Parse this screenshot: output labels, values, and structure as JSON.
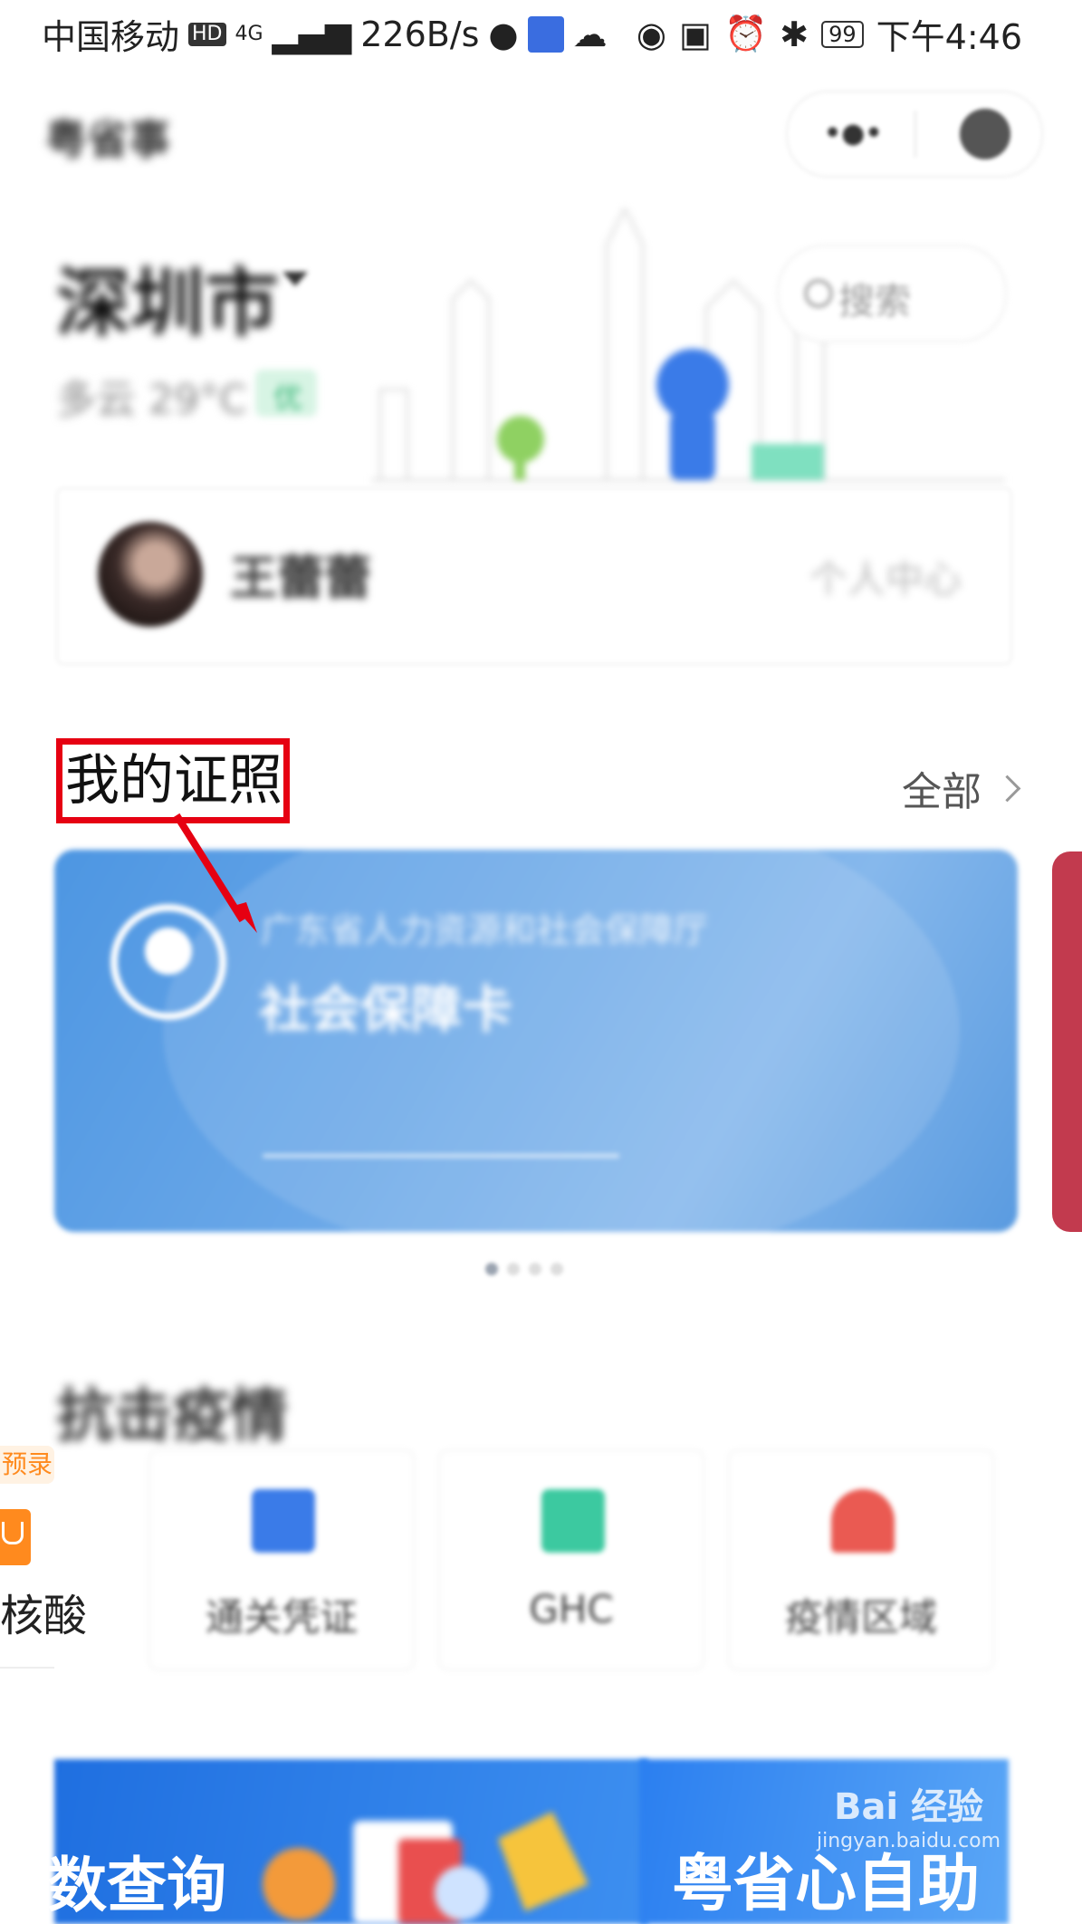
{
  "status_bar": {
    "carrier": "中国移动",
    "hd": "HD",
    "network": "4G",
    "speed": "226B/s",
    "battery": "99",
    "time": "下午4:46"
  },
  "app_bar": {
    "title": "粤省事",
    "more_icon": "more-dots-icon",
    "close_icon": "close-circle-icon"
  },
  "header": {
    "city": "深圳市",
    "weather": "多云 29°C",
    "air_quality": "优",
    "search_placeholder": "搜索"
  },
  "user": {
    "name": "王蕾蕾",
    "center_link": "个人中心"
  },
  "certificates": {
    "title": "我的证照",
    "more_label": "全部",
    "card": {
      "issuer": "广东省人力资源和社会保障厅",
      "name": "社会保障卡",
      "color": "#5a9be0"
    },
    "next_card_color": "#c23a4e",
    "highlight_color": "#e60012"
  },
  "epidemic": {
    "title": "抗击疫情",
    "partial_item": {
      "badge": "预录",
      "label": "核酸"
    },
    "items": [
      {
        "label": "通关凭证",
        "icon": "pass-icon",
        "color": "#3a7be8"
      },
      {
        "label": "GHC",
        "icon": "qr-code-icon",
        "color": "#3cc9a0"
      },
      {
        "label": "疫情区域",
        "icon": "alarm-icon",
        "color": "#ea5a52"
      }
    ]
  },
  "banners": {
    "left": "数查询",
    "right": "粤省心自助"
  },
  "watermark": {
    "brand": "Bai 经验",
    "url": "jingyan.baidu.com"
  }
}
